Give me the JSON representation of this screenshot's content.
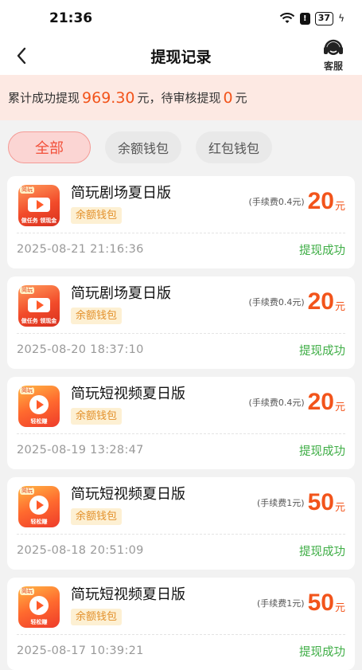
{
  "status_bar": {
    "time": "21:36",
    "battery": "37"
  },
  "nav": {
    "title": "提现记录",
    "service_label": "客服"
  },
  "summary": {
    "prefix": "累计成功提现",
    "total": "969.30",
    "mid": "元，待审核提现",
    "pending": "0",
    "suffix": "元"
  },
  "tabs": [
    "全部",
    "余额钱包",
    "红包钱包"
  ],
  "records": [
    {
      "app": "简玩剧场夏日版",
      "icon": "theater-app-icon",
      "wallet": "余额钱包",
      "fee": "(手续费0.4元)",
      "amount": "20",
      "unit": "元",
      "time": "2025-08-21 21:16:36",
      "status": "提现成功",
      "icon_badge": "简玩",
      "icon_footer": "做任务 领现金"
    },
    {
      "app": "简玩剧场夏日版",
      "icon": "theater-app-icon",
      "wallet": "余额钱包",
      "fee": "(手续费0.4元)",
      "amount": "20",
      "unit": "元",
      "time": "2025-08-20 18:37:10",
      "status": "提现成功",
      "icon_badge": "简玩",
      "icon_footer": "做任务 领现金"
    },
    {
      "app": "简玩短视频夏日版",
      "icon": "video-app-icon",
      "wallet": "余额钱包",
      "fee": "(手续费0.4元)",
      "amount": "20",
      "unit": "元",
      "time": "2025-08-19 13:28:47",
      "status": "提现成功",
      "icon_badge": "简玩",
      "icon_footer": "轻松赚"
    },
    {
      "app": "简玩短视频夏日版",
      "icon": "video-app-icon",
      "wallet": "余额钱包",
      "fee": "(手续费1元)",
      "amount": "50",
      "unit": "元",
      "time": "2025-08-18 20:51:09",
      "status": "提现成功",
      "icon_badge": "简玩",
      "icon_footer": "轻松赚"
    },
    {
      "app": "简玩短视频夏日版",
      "icon": "video-app-icon",
      "wallet": "余额钱包",
      "fee": "(手续费1元)",
      "amount": "50",
      "unit": "元",
      "time": "2025-08-17 10:39:21",
      "status": "提现成功",
      "icon_badge": "简玩",
      "icon_footer": "轻松赚"
    }
  ],
  "colors": {
    "accent": "#f2541b",
    "success": "#3fae46",
    "summary_bg": "#fde9e3",
    "tag_bg": "#fdf0d3"
  }
}
